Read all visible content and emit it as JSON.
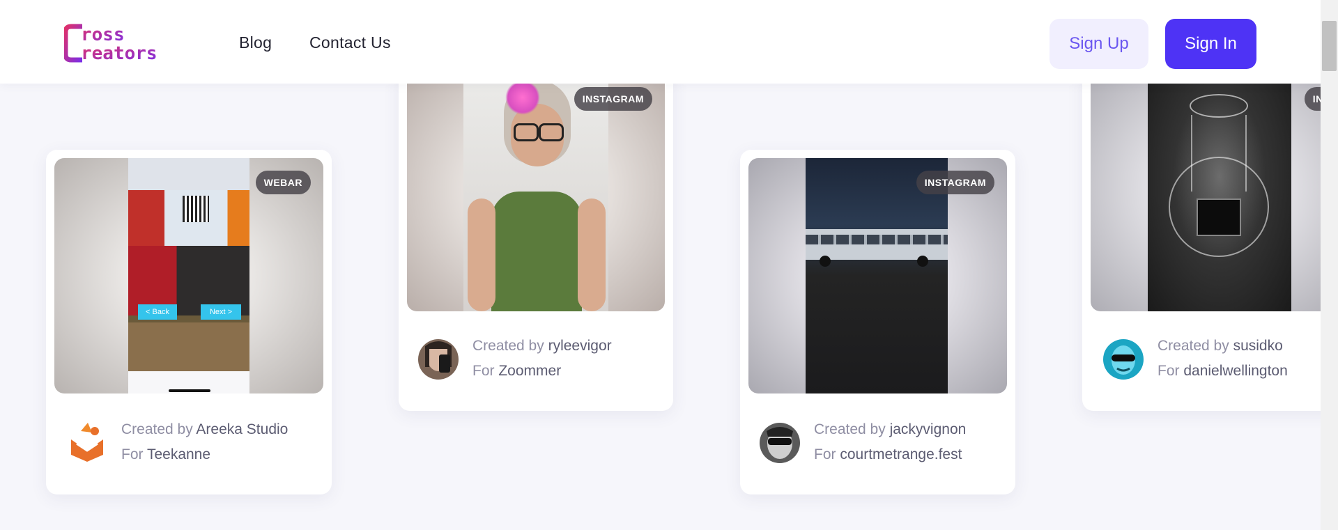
{
  "header": {
    "logo_line1": "ross",
    "logo_line2": "reators",
    "nav": [
      "Blog",
      "Contact Us"
    ],
    "signup_label": "Sign Up",
    "signin_label": "Sign In"
  },
  "cards": [
    {
      "badge": "WEBAR",
      "created_prefix": "Created by",
      "creator": "Areeka Studio",
      "for_prefix": "For",
      "brand": "Teekanne"
    },
    {
      "badge": "INSTAGRAM",
      "created_prefix": "Created by",
      "creator": "ryleevigor",
      "for_prefix": "For",
      "brand": "Zoommer"
    },
    {
      "badge": "INSTAGRAM",
      "created_prefix": "Created by",
      "creator": "jackyvignon",
      "for_prefix": "For",
      "brand": "courtmetrange.fest"
    },
    {
      "badge": "INSTAGRAM",
      "created_prefix": "Created by",
      "creator": "susidko",
      "for_prefix": "For",
      "brand": "danielwellington"
    }
  ],
  "webar_screen": {
    "back": "< Back",
    "next": "Next >"
  },
  "colors": {
    "accent": "#4e33f5",
    "signup_bg": "#f1effe",
    "badge_bg": "#464248"
  }
}
